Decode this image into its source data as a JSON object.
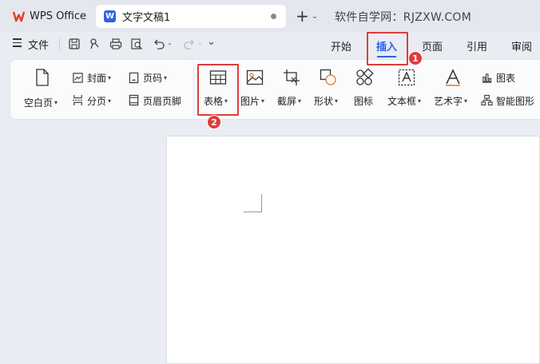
{
  "titlebar": {
    "app_tab": "WPS Office",
    "doc_tab": "文字文稿1",
    "doc_icon_letter": "W",
    "new_tab_symbol": "+",
    "new_tab_caret": "⌄",
    "watermark": "软件自学网：RJZXW.COM"
  },
  "menubar": {
    "file_label": "文件",
    "tabs": [
      "开始",
      "插入",
      "页面",
      "引用",
      "审阅"
    ],
    "active_tab": "插入"
  },
  "ribbon": {
    "blank_page": "空白页",
    "cover": "封面",
    "page_break": "分页",
    "page_number": "页码",
    "header_footer": "页眉页脚",
    "table": "表格",
    "picture": "图片",
    "screenshot": "截屏",
    "shape": "形状",
    "icon": "图标",
    "textbox": "文本框",
    "wordart": "艺术字",
    "chart": "图表",
    "smartart": "智能图形"
  },
  "annotations": {
    "badge1": "1",
    "badge2": "2",
    "highlight_color": "#e03c3c"
  },
  "colors": {
    "accent": "#2a62e8",
    "wps_red": "#e8392c",
    "doc_blue": "#2f64e6"
  }
}
